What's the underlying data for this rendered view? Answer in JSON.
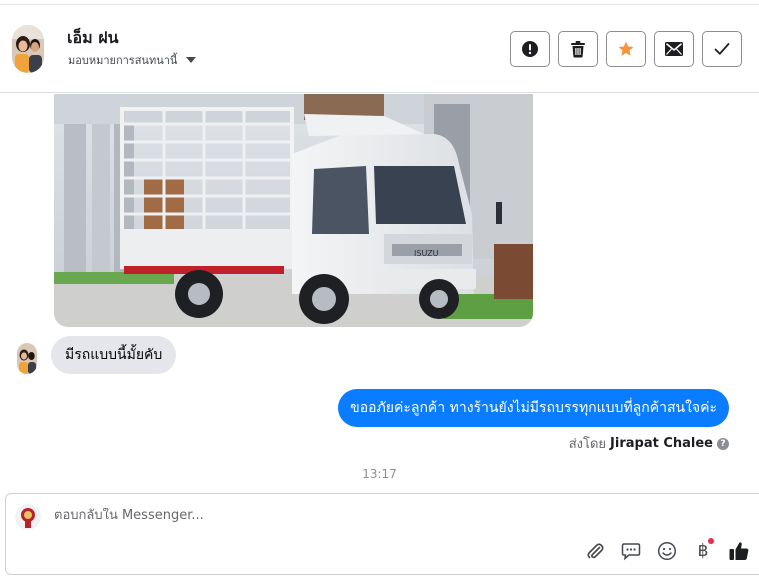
{
  "contact": {
    "name": "เอ็ม ฝน",
    "assign_label": "มอบหมายการสนทนานี้"
  },
  "header_actions": [
    {
      "icon": "alert-circle-icon"
    },
    {
      "icon": "trash-icon"
    },
    {
      "icon": "star-icon",
      "color": "#f7923b"
    },
    {
      "icon": "envelope-icon"
    },
    {
      "icon": "check-icon"
    }
  ],
  "messages": {
    "incoming_text": "มีรถแบบนี้มั้ยคับ",
    "outgoing_text": "ขออภัยค่ะลูกค้า ทางร้านยังไม่มีรถบรรทุกแบบที่ลูกค้าสนใจค่ะ",
    "sent_by_prefix": "ส่งโดย",
    "sent_by_name": "Jirapat Chalee",
    "timestamp": "13:17"
  },
  "truck_photo": {
    "brand_text": "ISUZU"
  },
  "composer": {
    "placeholder": "ตอบกลับใน Messenger...",
    "tools": [
      "paperclip-icon",
      "chat-bubble-icon",
      "smiley-icon",
      "baht-icon",
      "thumbs-up-icon"
    ],
    "baht_symbol": "฿"
  },
  "colors": {
    "outgoing_bubble": "#0a7cff",
    "incoming_bubble": "#e4e6eb",
    "star": "#f7923b",
    "notification_dot": "#f02849"
  }
}
